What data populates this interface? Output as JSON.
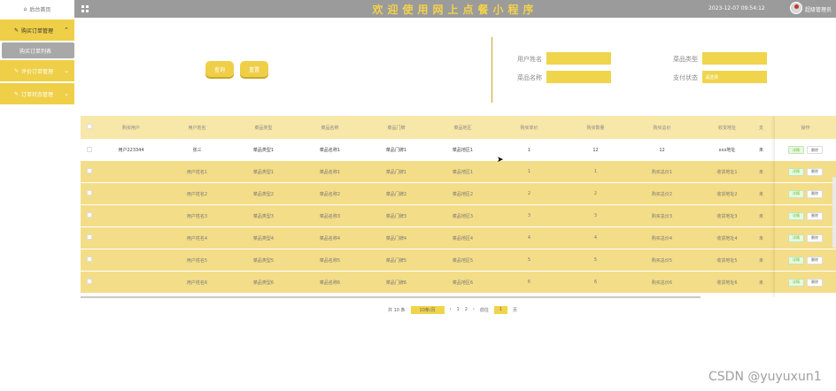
{
  "sidebar": {
    "home": "后台首页",
    "groups": [
      {
        "label": "购买订单管理",
        "active": true
      },
      {
        "label": "评价订单管理",
        "active": false
      },
      {
        "label": "订单状态管理",
        "active": false
      }
    ],
    "sub_active": "购买订单列表"
  },
  "header": {
    "title": "欢迎使用网上点餐小程序",
    "time": "2023-12-07 09:54:12",
    "user": "超级管理员"
  },
  "search": {
    "query_label": "查询",
    "reset_label": "重置",
    "fields": {
      "username_label": "用户姓名",
      "category_label": "菜品类型",
      "dish_label": "菜品名称",
      "pay_label": "支付状态",
      "pay_placeholder": "请选择"
    }
  },
  "table": {
    "headers": [
      "购买用户",
      "用户姓名",
      "菜品类型",
      "菜品名称",
      "菜品门牌",
      "菜品地区",
      "购买单价",
      "购买数量",
      "购买总价",
      "收货地址",
      "支"
    ],
    "op_header": "操作",
    "detail_label": "详情",
    "delete_label": "删除",
    "rows": [
      [
        "用户223344",
        "张三",
        "菜品类型1",
        "菜品名称1",
        "菜品门牌1",
        "菜品地区1",
        "1",
        "12",
        "12",
        "xxx地址",
        "未"
      ],
      [
        "",
        "用户姓名1",
        "菜品类型1",
        "菜品名称1",
        "菜品门牌1",
        "菜品地区1",
        "1",
        "1",
        "购买总价1",
        "收货地址1",
        "未"
      ],
      [
        "",
        "用户姓名2",
        "菜品类型2",
        "菜品名称2",
        "菜品门牌2",
        "菜品地区2",
        "2",
        "2",
        "购买总价2",
        "收货地址2",
        "未"
      ],
      [
        "",
        "用户姓名3",
        "菜品类型3",
        "菜品名称3",
        "菜品门牌3",
        "菜品地区3",
        "3",
        "3",
        "购买总价3",
        "收货地址3",
        "未"
      ],
      [
        "",
        "用户姓名4",
        "菜品类型4",
        "菜品名称4",
        "菜品门牌4",
        "菜品地区4",
        "4",
        "4",
        "购买总价4",
        "收货地址4",
        "未"
      ],
      [
        "",
        "用户姓名5",
        "菜品类型5",
        "菜品名称5",
        "菜品门牌5",
        "菜品地区5",
        "5",
        "5",
        "购买总价5",
        "收货地址5",
        "未"
      ],
      [
        "",
        "用户姓名6",
        "菜品类型6",
        "菜品名称6",
        "菜品门牌6",
        "菜品地区6",
        "6",
        "6",
        "购买总价6",
        "收货地址6",
        "未"
      ]
    ]
  },
  "pager": {
    "total": "共 10 条",
    "page_size": "10条/页",
    "prev": "‹",
    "pages": [
      "1",
      "2"
    ],
    "next": "›",
    "goto": "前往",
    "current": "1",
    "unit": "页"
  },
  "watermark": "CSDN @yuyuxun1",
  "colors": {
    "accent": "#efcf47",
    "header_bg": "#9b9b9b",
    "row_yellow": "#f4dd88"
  }
}
